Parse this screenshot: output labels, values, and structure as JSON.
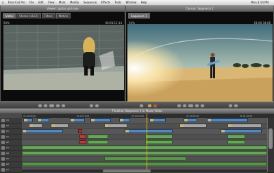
{
  "menubar": {
    "apple": "",
    "items": [
      "Final Cut Pro",
      "File",
      "Edit",
      "View",
      "Mark",
      "Modify",
      "Sequence",
      "Effects",
      "Tools",
      "Window",
      "Help"
    ],
    "clock": "Mon 3:14 PM"
  },
  "viewer": {
    "title": "Viewer: guitar_girl.mov",
    "tabs": [
      "Video",
      "Stereo (a1a2)",
      "Filters",
      "Motion"
    ],
    "timecode": "00:00:12;14",
    "zoom": "50%"
  },
  "canvas": {
    "title": "Canvas: Sequence 1",
    "tabs": [
      "Sequence 1"
    ],
    "timecode": "01:00:34;06",
    "zoom": "50%"
  },
  "timeline": {
    "title": "Timeline: Sequence 1 in Music Video",
    "ruler": [
      "01:00:00;00",
      "01:00:15;00",
      "01:00:30;00",
      "01:00:45;00",
      "01:01:00;00"
    ],
    "tracks": [
      "V3",
      "V2",
      "V1",
      "A1",
      "A2",
      "A3",
      "A4",
      "A5",
      "A6",
      "A7"
    ]
  },
  "colors": {
    "accent": "#3f78ad",
    "audio_clip": "#6aa35a",
    "playhead": "#e0c000"
  }
}
